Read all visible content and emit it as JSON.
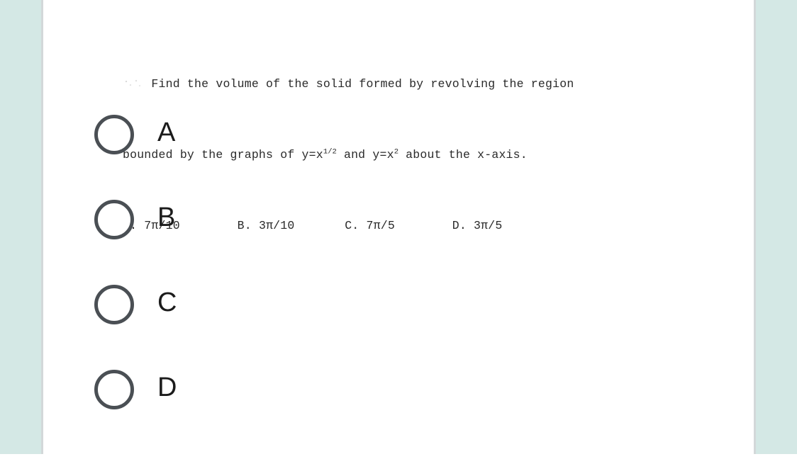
{
  "page": {
    "background_color": "#ffffff",
    "side_band_color": "#d4e8e5",
    "card_color": "#ffffff",
    "card_edge_color": "#d3d8d9"
  },
  "question": {
    "line1_indent": "    ",
    "line1": "Find the volume of the solid formed by revolving the region",
    "line2_prefix": "bounded by the graphs of y=x",
    "line2_sup1": "1/2",
    "line2_mid": " and y=x",
    "line2_sup2": "2",
    "line2_suffix": " about the x-axis.",
    "choices_line": {
      "a": "A. 7π/10",
      "gap1": "        ",
      "b": "B. 3π/10",
      "gap2": "       ",
      "c": "C. 7π/5",
      "gap3": "        ",
      "d": "D. 3π/5"
    }
  },
  "options": {
    "radio_color": "#4a4f54",
    "label_color": "#1b1b1b",
    "items": [
      {
        "id": "A",
        "label": "A",
        "selected": false
      },
      {
        "id": "B",
        "label": "B",
        "selected": false
      },
      {
        "id": "C",
        "label": "C",
        "selected": false
      },
      {
        "id": "D",
        "label": "D",
        "selected": false
      }
    ]
  }
}
